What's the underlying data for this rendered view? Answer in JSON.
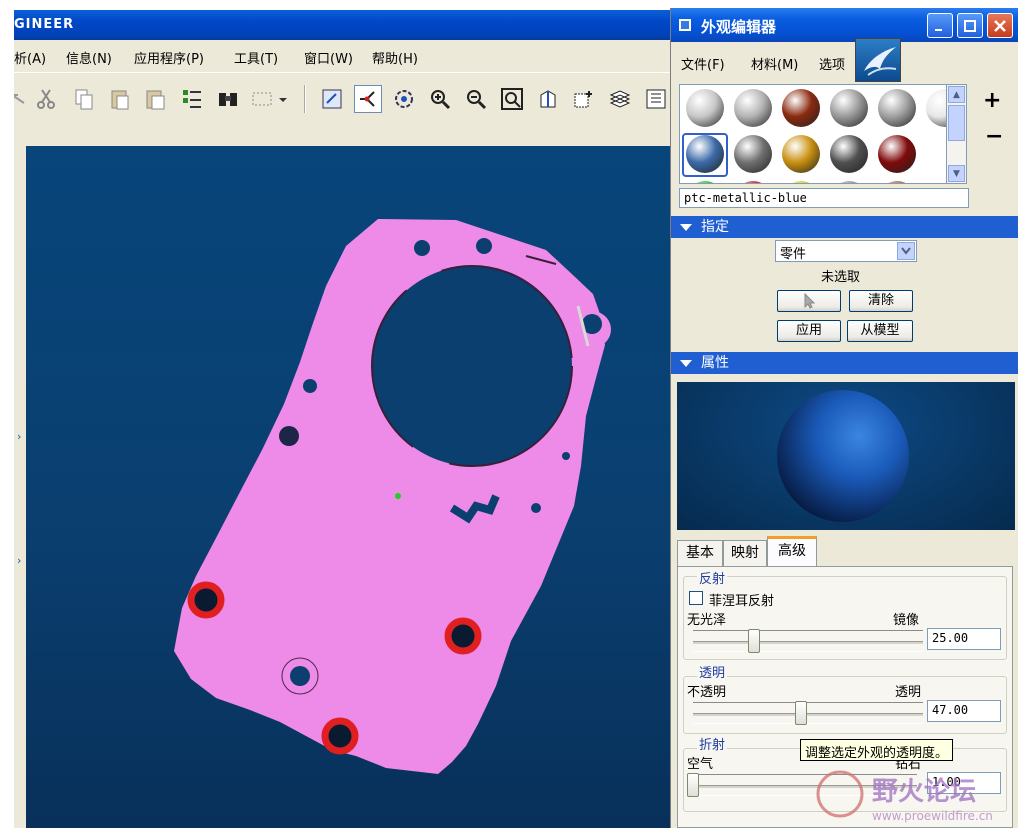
{
  "main_window": {
    "title": "GINEER",
    "menu": [
      "析(A)",
      "信息(N)",
      "应用程序(P)",
      "工具(T)",
      "窗口(W)",
      "帮助(H)"
    ]
  },
  "toolbar": {
    "buttons": [
      "undo-arrow-icon",
      "cut-icon",
      "copy-icon",
      "paste-icon",
      "paste-special-icon",
      "regenerate-icon",
      "find-icon",
      "select-box-icon",
      "dropdown-arrow-icon",
      "repaint-icon",
      "spin-center-icon",
      "orient-icon",
      "zoom-in-icon",
      "zoom-out-icon",
      "refit-icon",
      "view-manager-icon",
      "saved-views-icon",
      "layers-icon",
      "model-tree-icon"
    ]
  },
  "part": {
    "color": "#ee8ae8",
    "hole_highlight": "#e02020"
  },
  "editor": {
    "title": "外观编辑器",
    "menu": [
      "文件(F)",
      "材料(M)",
      "选项"
    ],
    "material_name": "ptc-metallic-blue",
    "swatches": {
      "row1": [
        "#c8c8c8",
        "#b4b4b4",
        "#8a2a10",
        "#9a9a9a",
        "#a0a0a0",
        "#e8e8e8"
      ],
      "row2": [
        "#3c6aa8",
        "#707070",
        "#c89010",
        "#505050",
        "#800a0a"
      ],
      "row3": [
        "#20c020",
        "#d01010",
        "#d0d010",
        "#909090",
        "#b06030"
      ]
    },
    "add_label": "+",
    "remove_label": "−",
    "assign": {
      "header": "指定",
      "select_value": "零件",
      "status": "未选取",
      "clear_label": "清除",
      "apply_label": "应用",
      "from_model_label": "从模型"
    },
    "properties": {
      "header": "属性",
      "sphere_color": "#1a5ab8",
      "tabs": [
        "基本",
        "映射",
        "高级"
      ],
      "active_tab": "高级",
      "reflection": {
        "title": "反射",
        "fresnel_label": "菲涅耳反射",
        "min_label": "无光泽",
        "max_label": "镜像",
        "value": "25.00",
        "level": 0.25
      },
      "transparency": {
        "title": "透明",
        "min_label": "不透明",
        "max_label": "透明",
        "value": "47.00",
        "level": 0.47
      },
      "refraction": {
        "title": "折射",
        "min_label": "空气",
        "max_label": "钻石",
        "value": "1.00",
        "level": 0.0
      }
    },
    "tooltip": "调整选定外观的透明度。"
  },
  "watermark": {
    "text": "野火论坛",
    "url": "www.proewildfire.cn"
  }
}
